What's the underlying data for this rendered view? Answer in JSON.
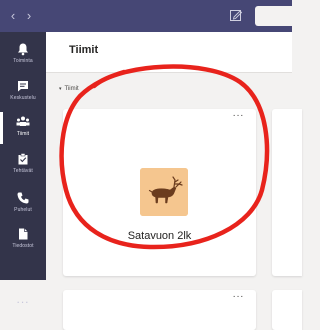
{
  "colors": {
    "titlebar": "#464775",
    "rail": "#33344a",
    "annotation": "#e8231c",
    "avatar_bg": "#f5c68f"
  },
  "titlebar": {
    "back_icon": "chevron-left-icon",
    "forward_icon": "chevron-right-icon",
    "compose_icon": "compose-icon"
  },
  "rail": {
    "items": [
      {
        "label": "Toiminta",
        "icon": "bell-icon"
      },
      {
        "label": "Keskustelu",
        "icon": "chat-icon"
      },
      {
        "label": "Tiimit",
        "icon": "teams-icon",
        "active": true
      },
      {
        "label": "Tehtävät",
        "icon": "assignments-icon"
      },
      {
        "label": "Puhelut",
        "icon": "phone-icon"
      },
      {
        "label": "Tiedostot",
        "icon": "files-icon"
      }
    ],
    "more": "..."
  },
  "header": {
    "title": "Tiimit"
  },
  "section": {
    "caret": "▾",
    "label": "Tiimit"
  },
  "teams": [
    {
      "name": "Satavuon 2lk",
      "more": "···"
    },
    {
      "name": "",
      "more": "···"
    }
  ]
}
